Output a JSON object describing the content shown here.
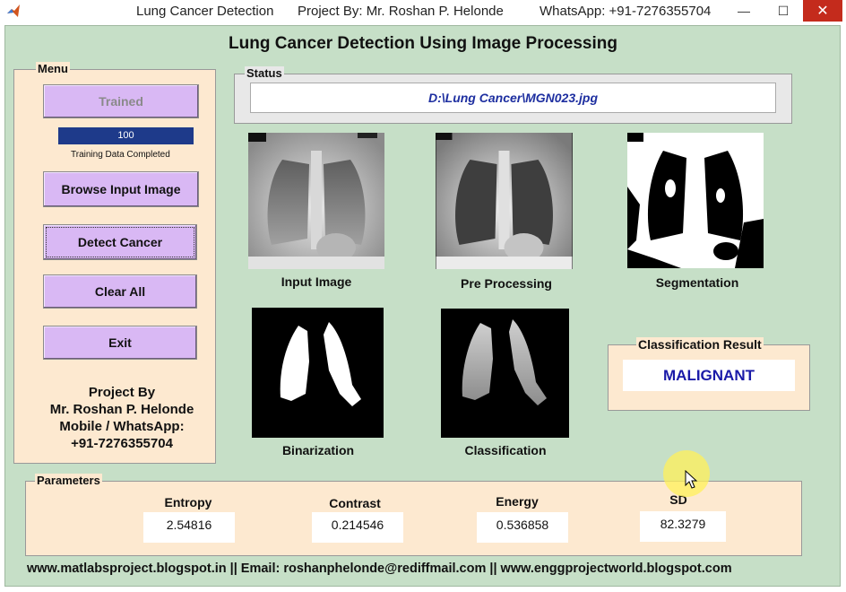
{
  "titlebar": {
    "app_title": "Lung Cancer Detection",
    "project_by": "Project By: Mr. Roshan P. Helonde",
    "whatsapp": "WhatsApp: +91-7276355704"
  },
  "main_title": "Lung Cancer Detection Using Image Processing",
  "menu": {
    "legend": "Menu",
    "trained_label": "Trained",
    "progress_value": "100",
    "progress_caption": "Training Data Completed",
    "browse_label": "Browse Input Image",
    "detect_label": "Detect Cancer",
    "clear_label": "Clear All",
    "exit_label": "Exit",
    "credit": {
      "line1": "Project By",
      "line2": "Mr. Roshan P. Helonde",
      "line3": "Mobile / WhatsApp:",
      "line4": "+91-7276355704"
    }
  },
  "status": {
    "legend": "Status",
    "path": "D:\\Lung Cancer\\MGN023.jpg"
  },
  "images": {
    "input": "Input Image",
    "pre": "Pre Processing",
    "seg": "Segmentation",
    "bin": "Binarization",
    "cls": "Classification"
  },
  "classification": {
    "legend": "Classification Result",
    "result": "MALIGNANT"
  },
  "parameters": {
    "legend": "Parameters",
    "entropy_label": "Entropy",
    "entropy_value": "2.54816",
    "contrast_label": "Contrast",
    "contrast_value": "0.214546",
    "energy_label": "Energy",
    "energy_value": "0.536858",
    "sd_label": "SD",
    "sd_value": "82.3279"
  },
  "footer": "www.matlabsproject.blogspot.in  || Email: roshanphelonde@rediffmail.com ||  www.enggprojectworld.blogspot.com",
  "colors": {
    "window_bg": "#c6dfc7",
    "panel_bg": "#fde9d0",
    "button_bg": "#d9b8f4",
    "progress_fill": "#1e3a8a",
    "result_text": "#1a1aa8"
  }
}
